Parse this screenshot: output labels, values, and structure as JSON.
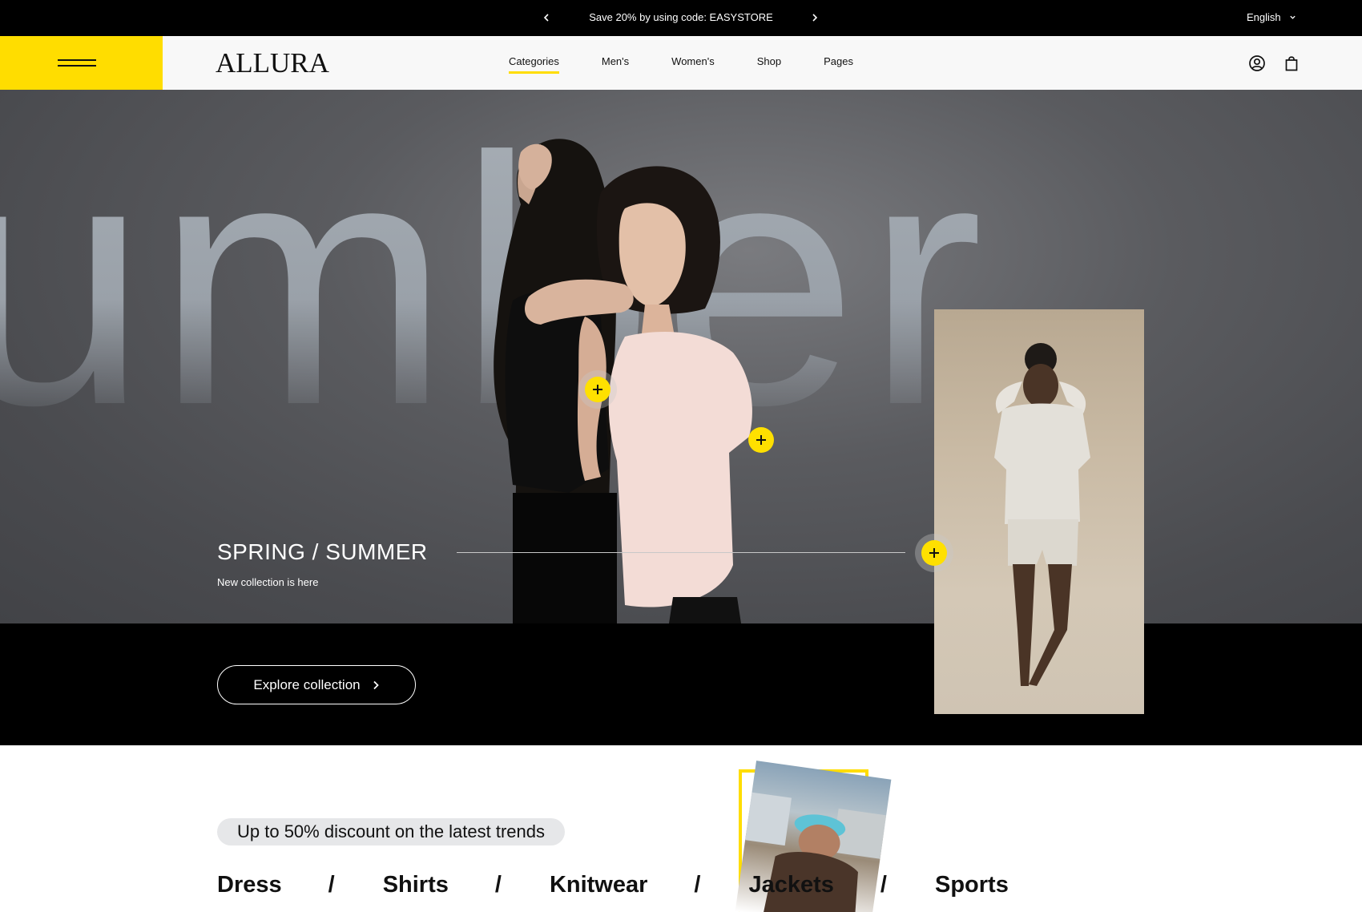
{
  "announcement": {
    "message": "Save 20% by using code: EASYSTORE",
    "language": "English"
  },
  "header": {
    "logo": "ALLURA",
    "nav": [
      {
        "label": "Categories",
        "active": true
      },
      {
        "label": "Men's",
        "active": false
      },
      {
        "label": "Women's",
        "active": false
      },
      {
        "label": "Shop",
        "active": false
      },
      {
        "label": "Pages",
        "active": false
      }
    ]
  },
  "hero": {
    "background_word": "umber",
    "title": "SPRING / SUMMER",
    "subtitle": "New collection is here",
    "cta_label": "Explore collection"
  },
  "promo": {
    "discount_label": "Up to 50% discount on the latest trends",
    "categories": [
      "Dress",
      "Shirts",
      "Knitwear",
      "Jackets",
      "Sports"
    ],
    "separator": "/"
  },
  "colors": {
    "accent": "#ffdd00",
    "dark": "#000000",
    "light": "#f8f8f8"
  }
}
